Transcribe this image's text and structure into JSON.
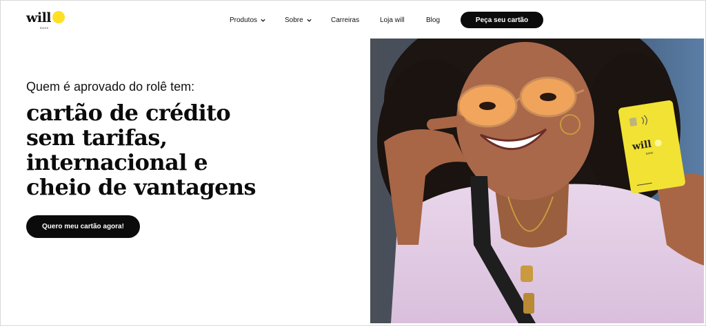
{
  "brand": {
    "name": "will",
    "sub": "BANK",
    "accent": "#ffe023"
  },
  "nav": {
    "items": [
      {
        "label": "Produtos",
        "dropdown": true
      },
      {
        "label": "Sobre",
        "dropdown": true
      },
      {
        "label": "Carreiras",
        "dropdown": false
      },
      {
        "label": "Loja will",
        "dropdown": false
      },
      {
        "label": "Blog",
        "dropdown": false
      }
    ],
    "cta_label": "Peça seu cartão"
  },
  "hero": {
    "subtitle": "Quem é aprovado do rolê tem:",
    "title_lines": [
      "cartão de crédito",
      "sem tarifas,",
      "internacional e",
      "cheio de vantagens"
    ],
    "cta_label": "Quero meu cartão agora!"
  },
  "photo": {
    "card": {
      "brand": "will",
      "sub": "BANK",
      "color": "#f2e233"
    }
  }
}
